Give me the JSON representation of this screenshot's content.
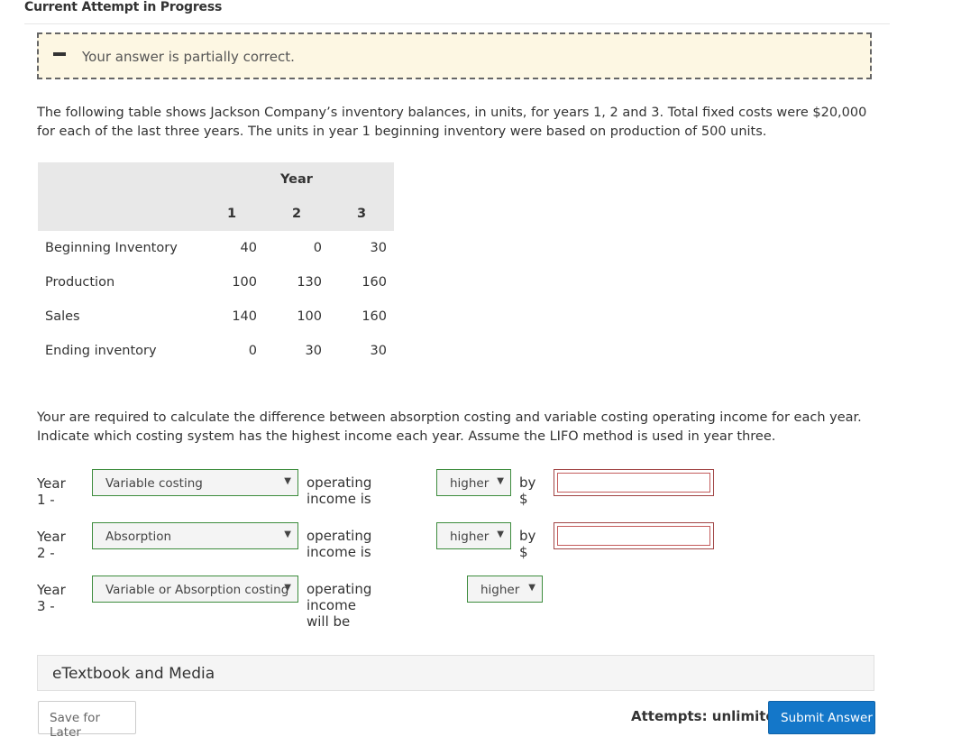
{
  "page": {
    "title": "Current Attempt in Progress"
  },
  "feedback": {
    "message": "Your answer is partially correct."
  },
  "problem": {
    "intro": "The following table shows Jackson Company’s inventory balances, in units, for years 1, 2 and 3. Total fixed costs were $20,000 for each of the last three years. The units in year 1 beginning inventory were based on production of 500 units.",
    "requirement": "Your are required to calculate the difference between absorption costing and variable costing operating income for each year. Indicate which costing system has the highest income each year. Assume the LIFO method is used in year three."
  },
  "table": {
    "year_header": "Year",
    "years": [
      "1",
      "2",
      "3"
    ],
    "rows": [
      {
        "label": "Beginning Inventory",
        "values": [
          "40",
          "0",
          "30"
        ]
      },
      {
        "label": "Production",
        "values": [
          "100",
          "130",
          "160"
        ]
      },
      {
        "label": "Sales",
        "values": [
          "140",
          "100",
          "160"
        ]
      },
      {
        "label": "Ending inventory",
        "values": [
          "0",
          "30",
          "30"
        ]
      }
    ]
  },
  "answers": {
    "year1": {
      "label": "Year 1 -",
      "system": "Variable costing",
      "text": "operating income is",
      "direction": "higher",
      "by": "by $",
      "amount": ""
    },
    "year2": {
      "label": "Year 2 -",
      "system": "Absorption",
      "text": "operating income is",
      "direction": "higher",
      "by": "by $",
      "amount": ""
    },
    "year3": {
      "label": "Year 3 -",
      "system": "Variable or Absorption costing",
      "text": "operating income will be",
      "direction": "higher"
    }
  },
  "etextbook": {
    "label": "eTextbook and Media"
  },
  "footer": {
    "save_label": "Save for Later",
    "attempts": "Attempts: unlimited",
    "submit_label": "Submit Answer"
  },
  "colors": {
    "feedback_bg": "#fdf7e3",
    "select_border": "#3d8c3d",
    "amount_border": "#a14545",
    "submit_bg": "#1477c9"
  }
}
